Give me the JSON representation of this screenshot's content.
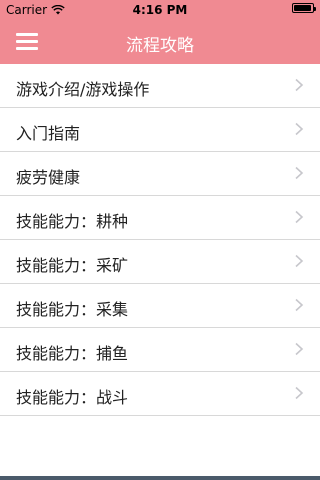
{
  "status": {
    "carrier": "Carrier",
    "time": "4:16 PM"
  },
  "header": {
    "title": "流程攻略"
  },
  "colors": {
    "accent": "#f08a92",
    "separator": "#d8d8d8",
    "chevron": "#c7c7cc"
  },
  "list": {
    "items": [
      {
        "label": "游戏介绍/游戏操作"
      },
      {
        "label": "入门指南"
      },
      {
        "label": "疲劳健康"
      },
      {
        "label": "技能能力：耕种"
      },
      {
        "label": "技能能力：采矿"
      },
      {
        "label": "技能能力：采集"
      },
      {
        "label": "技能能力：捕鱼"
      },
      {
        "label": "技能能力：战斗"
      }
    ]
  }
}
